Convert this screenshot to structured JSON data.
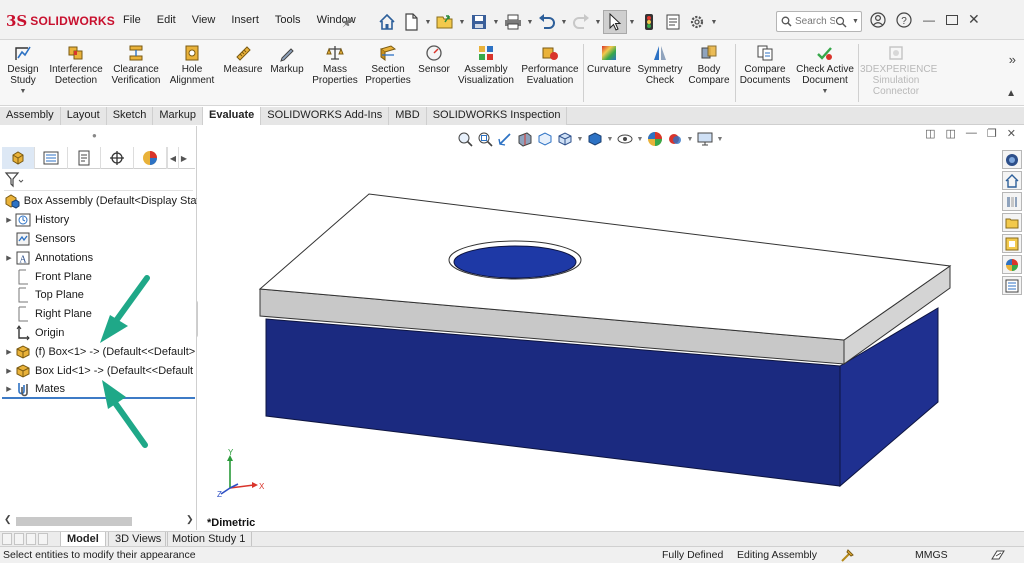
{
  "app": {
    "logo_ds": "3S",
    "logo_name": "SOLIDWORKS"
  },
  "menu": [
    "File",
    "Edit",
    "View",
    "Insert",
    "Tools",
    "Window"
  ],
  "search": {
    "placeholder": "Search S"
  },
  "command_manager": {
    "items": [
      {
        "label1": "Design",
        "label2": "Study",
        "icon": "design-study-icon"
      },
      {
        "label1": "Interference",
        "label2": "Detection",
        "icon": "interference-detection-icon"
      },
      {
        "label1": "Clearance",
        "label2": "Verification",
        "icon": "clearance-verification-icon"
      },
      {
        "label1": "Hole",
        "label2": "Alignment",
        "icon": "hole-alignment-icon"
      },
      {
        "label1": "Measure",
        "label2": "",
        "icon": "measure-icon"
      },
      {
        "label1": "Markup",
        "label2": "",
        "icon": "markup-icon"
      },
      {
        "label1": "Mass",
        "label2": "Properties",
        "icon": "mass-properties-icon"
      },
      {
        "label1": "Section",
        "label2": "Properties",
        "icon": "section-properties-icon"
      },
      {
        "label1": "Sensor",
        "label2": "",
        "icon": "sensor-icon"
      },
      {
        "label1": "Assembly",
        "label2": "Visualization",
        "icon": "assembly-visualization-icon"
      },
      {
        "label1": "Performance",
        "label2": "Evaluation",
        "icon": "performance-evaluation-icon"
      },
      {
        "label1": "Curvature",
        "label2": "",
        "icon": "curvature-icon"
      },
      {
        "label1": "Symmetry",
        "label2": "Check",
        "icon": "symmetry-check-icon"
      },
      {
        "label1": "Body",
        "label2": "Compare",
        "icon": "body-compare-icon"
      },
      {
        "label1": "Compare",
        "label2": "Documents",
        "icon": "compare-documents-icon"
      },
      {
        "label1": "Check Active",
        "label2": "Document",
        "icon": "check-active-document-icon"
      },
      {
        "label1": "3DEXPERIENCE",
        "label2": "Simulation",
        "label3": "Connector",
        "icon": "3dexperience-icon"
      }
    ]
  },
  "tabs": [
    "Assembly",
    "Layout",
    "Sketch",
    "Markup",
    "Evaluate",
    "SOLIDWORKS Add-Ins",
    "MBD",
    "SOLIDWORKS Inspection"
  ],
  "active_tab": "Evaluate",
  "feature_tree": {
    "root": "Box Assembly  (Default<Display State-",
    "items": [
      {
        "label": "History",
        "expandable": true,
        "icon": "history-icon"
      },
      {
        "label": "Sensors",
        "expandable": false,
        "icon": "sensors-icon"
      },
      {
        "label": "Annotations",
        "expandable": true,
        "icon": "annotations-icon"
      },
      {
        "label": "Front Plane",
        "expandable": false,
        "icon": "plane-icon"
      },
      {
        "label": "Top Plane",
        "expandable": false,
        "icon": "plane-icon"
      },
      {
        "label": "Right Plane",
        "expandable": false,
        "icon": "plane-icon"
      },
      {
        "label": "Origin",
        "expandable": false,
        "icon": "origin-icon"
      },
      {
        "label": "(f) Box<1> -> (Default<<Default>",
        "expandable": true,
        "icon": "part-icon"
      },
      {
        "label": "Box Lid<1> -> (Default<<Default",
        "expandable": true,
        "icon": "part-icon"
      },
      {
        "label": "Mates",
        "expandable": true,
        "icon": "mates-icon"
      }
    ]
  },
  "viewport": {
    "view_name": "*Dimetric",
    "triad": {
      "x": "X",
      "y": "Y",
      "z": "Z"
    }
  },
  "bottom_tabs": [
    "Model",
    "3D Views",
    "Motion Study 1"
  ],
  "active_bottom_tab": "Model",
  "status": {
    "message": "Select entities to modify their appearance",
    "state": "Fully Defined",
    "mode": "Editing Assembly",
    "units": "MMGS"
  },
  "colors": {
    "brand": "#c8102e",
    "box_blue": "#1b2a80",
    "lid_gray": "#c8c8c8",
    "arrow_green": "#1fa888"
  }
}
